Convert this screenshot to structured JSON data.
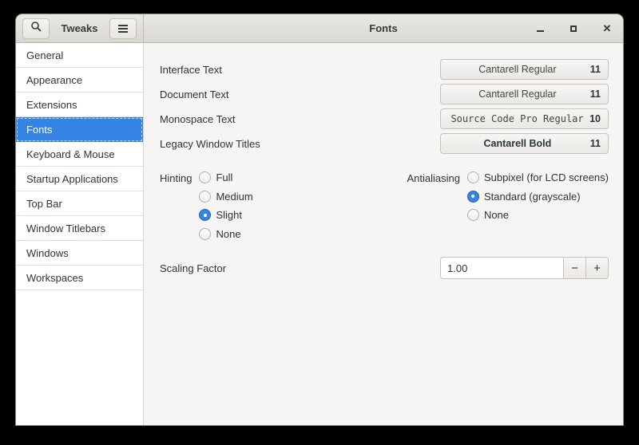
{
  "window": {
    "title": "Fonts"
  },
  "titlebar": {
    "app_title": "Tweaks"
  },
  "sidebar": {
    "items": [
      {
        "label": "General",
        "selected": false
      },
      {
        "label": "Appearance",
        "selected": false
      },
      {
        "label": "Extensions",
        "selected": false
      },
      {
        "label": "Fonts",
        "selected": true
      },
      {
        "label": "Keyboard & Mouse",
        "selected": false
      },
      {
        "label": "Startup Applications",
        "selected": false
      },
      {
        "label": "Top Bar",
        "selected": false
      },
      {
        "label": "Window Titlebars",
        "selected": false
      },
      {
        "label": "Windows",
        "selected": false
      },
      {
        "label": "Workspaces",
        "selected": false
      }
    ]
  },
  "content": {
    "font_rows": [
      {
        "label": "Interface Text",
        "font": "Cantarell Regular",
        "size": "11"
      },
      {
        "label": "Document Text",
        "font": "Cantarell Regular",
        "size": "11"
      },
      {
        "label": "Monospace Text",
        "font": "Source Code Pro Regular",
        "size": "10"
      },
      {
        "label": "Legacy Window Titles",
        "font": "Cantarell Bold",
        "size": "11"
      }
    ],
    "hinting": {
      "label": "Hinting",
      "options": [
        {
          "label": "Full"
        },
        {
          "label": "Medium"
        },
        {
          "label": "Slight"
        },
        {
          "label": "None"
        }
      ],
      "selected": "Slight"
    },
    "antialiasing": {
      "label": "Antialiasing",
      "options": [
        {
          "label": "Subpixel (for LCD screens)"
        },
        {
          "label": "Standard (grayscale)"
        },
        {
          "label": "None"
        }
      ],
      "selected": "Standard (grayscale)"
    },
    "scaling": {
      "label": "Scaling Factor",
      "value": "1.00",
      "decrease_label": "−",
      "increase_label": "+"
    }
  },
  "icons": {
    "search": "magnifier",
    "menu": "hamburger",
    "minimize": "horizontal-line",
    "maximize": "square-outline",
    "close": "✕"
  },
  "colors": {
    "accent": "#3584e4",
    "titlebar_bg": "#e0ddd8",
    "sidebar_bg": "#ffffff",
    "main_bg": "#f6f5f3",
    "text": "#2e3436"
  }
}
